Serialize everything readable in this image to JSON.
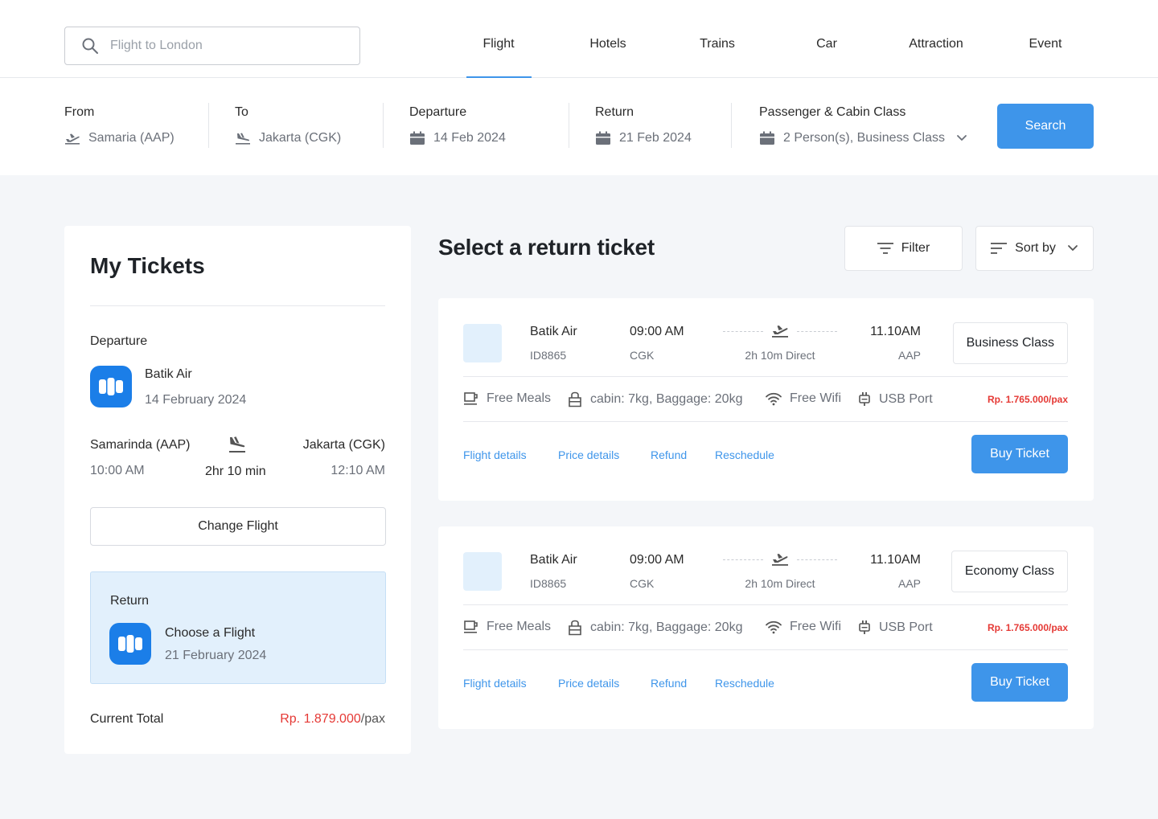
{
  "search": {
    "placeholder": "Flight to London"
  },
  "nav": {
    "tabs": [
      {
        "label": "Flight"
      },
      {
        "label": "Hotels"
      },
      {
        "label": "Trains"
      },
      {
        "label": "Car"
      },
      {
        "label": "Attraction"
      },
      {
        "label": "Event"
      }
    ],
    "active_tab": "Flight"
  },
  "booking": {
    "from_label": "From",
    "from_value": "Samaria (AAP)",
    "to_label": "To",
    "to_value": "Jakarta (CGK)",
    "departure_label": "Departure",
    "departure_value": "14 Feb 2024",
    "return_label": "Return",
    "return_value": "21 Feb 2024",
    "passenger_label": "Passenger & Cabin Class",
    "passenger_value": "2 Person(s), Business Class",
    "search_button": "Search"
  },
  "my_tickets": {
    "title": "My Tickets",
    "departure_label": "Departure",
    "airline": "Batik Air",
    "date": "14 February 2024",
    "from": "Samarinda (AAP)",
    "from_time": "10:00 AM",
    "to": "Jakarta (CGK)",
    "to_time": "12:10 AM",
    "duration": "2hr 10 min",
    "change_button": "Change Flight",
    "return_label": "Return",
    "return_title": "Choose a Flight",
    "return_date": "21 February 2024",
    "total_label": "Current Total",
    "total_amount": "Rp. 1.879.000",
    "total_unit": "/pax"
  },
  "main": {
    "title": "Select a return ticket",
    "filter_label": "Filter",
    "sort_label": "Sort by"
  },
  "tickets": [
    {
      "airline": "Batik Air",
      "code": "ID8865",
      "depart_time": "09:00 AM",
      "depart_port": "CGK",
      "duration": "2h 10m Direct",
      "arrive_time": "11.10AM",
      "arrive_port": "AAP",
      "class": "Business Class",
      "features": [
        "Free Meals",
        "cabin: 7kg, Baggage: 20kg",
        "Free Wifi",
        "USB Port"
      ],
      "price": "Rp. 1.765.000/pax",
      "links": [
        "Flight details",
        "Price details",
        "Refund",
        "Reschedule"
      ],
      "buy_label": "Buy Ticket"
    },
    {
      "airline": "Batik Air",
      "code": "ID8865",
      "depart_time": "09:00 AM",
      "depart_port": "CGK",
      "duration": "2h 10m Direct",
      "arrive_time": "11.10AM",
      "arrive_port": "AAP",
      "class": "Economy Class",
      "features": [
        "Free Meals",
        "cabin: 7kg, Baggage: 20kg",
        "Free Wifi",
        "USB Port"
      ],
      "price": "Rp. 1.765.000/pax",
      "links": [
        "Flight details",
        "Price details",
        "Refund",
        "Reschedule"
      ],
      "buy_label": "Buy Ticket"
    }
  ],
  "colors": {
    "accent": "#3e95ea",
    "price": "#e53935",
    "background": "#f4f6f9",
    "return_box": "#e2f0fc"
  },
  "icons": [
    "search-icon",
    "takeoff-icon",
    "landing-icon",
    "calendar-icon",
    "chevron-down-icon",
    "filter-icon",
    "airline-logo-icon",
    "meal-icon",
    "baggage-icon",
    "wifi-icon",
    "usb-icon"
  ]
}
